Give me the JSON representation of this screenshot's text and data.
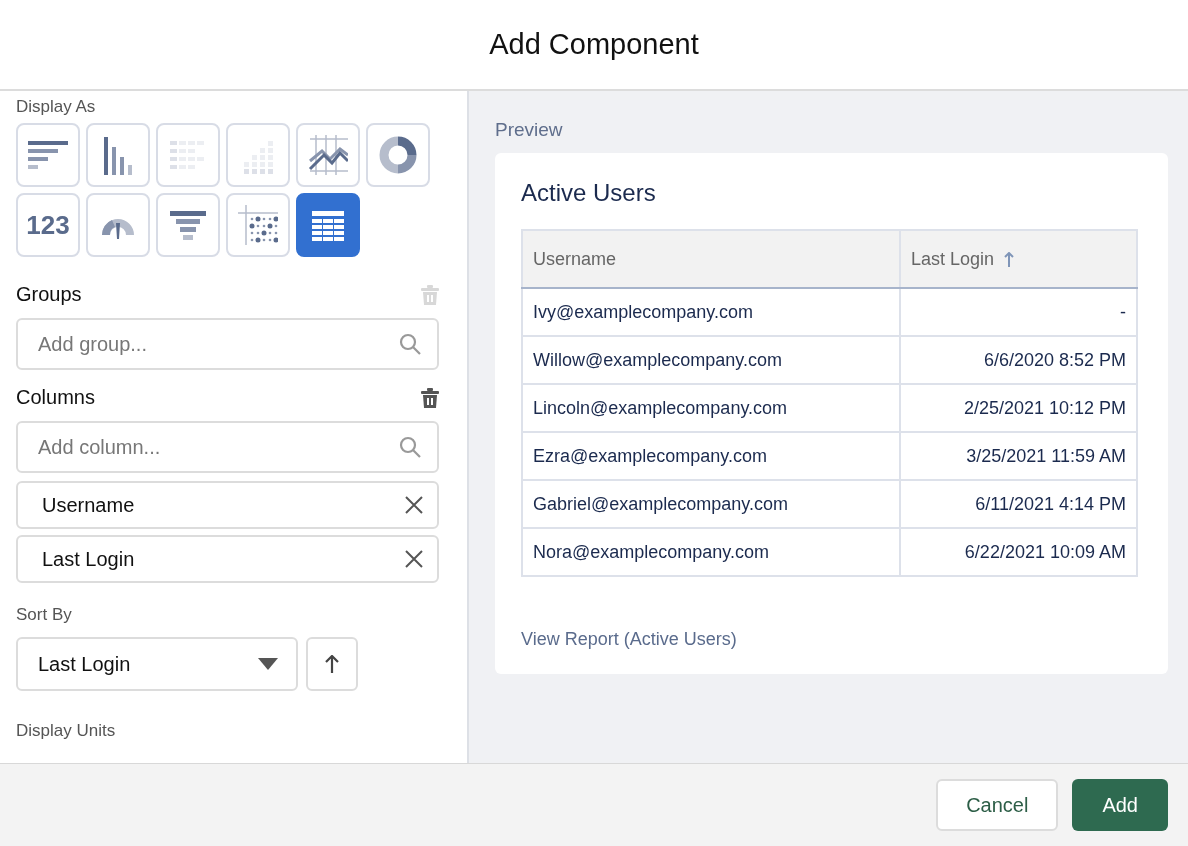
{
  "dialog": {
    "title": "Add Component"
  },
  "display_as": {
    "label": "Display As",
    "options": [
      {
        "kind": "hbar",
        "selected": false,
        "disabled": false
      },
      {
        "kind": "vbar",
        "selected": false,
        "disabled": false
      },
      {
        "kind": "stacked-hbar",
        "selected": false,
        "disabled": true
      },
      {
        "kind": "stacked-vbar",
        "selected": false,
        "disabled": true
      },
      {
        "kind": "line",
        "selected": false,
        "disabled": false
      },
      {
        "kind": "donut",
        "selected": false,
        "disabled": false
      },
      {
        "kind": "metric",
        "selected": false,
        "disabled": false,
        "text": "123"
      },
      {
        "kind": "gauge",
        "selected": false,
        "disabled": false
      },
      {
        "kind": "funnel",
        "selected": false,
        "disabled": false
      },
      {
        "kind": "scatter",
        "selected": false,
        "disabled": false
      },
      {
        "kind": "table",
        "selected": true,
        "disabled": false
      }
    ]
  },
  "groups": {
    "label": "Groups",
    "delete_disabled": true,
    "placeholder": "Add group..."
  },
  "columns": {
    "label": "Columns",
    "delete_disabled": false,
    "placeholder": "Add column...",
    "items": [
      "Username",
      "Last Login"
    ]
  },
  "sort_by": {
    "label": "Sort By",
    "value": "Last Login"
  },
  "display_units": {
    "label": "Display Units"
  },
  "preview": {
    "label": "Preview",
    "card_title": "Active Users",
    "table": {
      "columns": [
        {
          "label": "Username",
          "sorted": false
        },
        {
          "label": "Last Login",
          "sorted": true
        }
      ],
      "rows": [
        [
          "Ivy@examplecompany.com",
          "-"
        ],
        [
          "Willow@examplecompany.com",
          "6/6/2020 8:52 PM"
        ],
        [
          "Lincoln@examplecompany.com",
          "2/25/2021 10:12 PM"
        ],
        [
          "Ezra@examplecompany.com",
          "3/25/2021 11:59 AM"
        ],
        [
          "Gabriel@examplecompany.com",
          "6/11/2021 4:14 PM"
        ],
        [
          "Nora@examplecompany.com",
          "6/22/2021 10:09 AM"
        ]
      ]
    },
    "link": "View Report (Active Users)"
  },
  "buttons": {
    "cancel": "Cancel",
    "add": "Add"
  }
}
